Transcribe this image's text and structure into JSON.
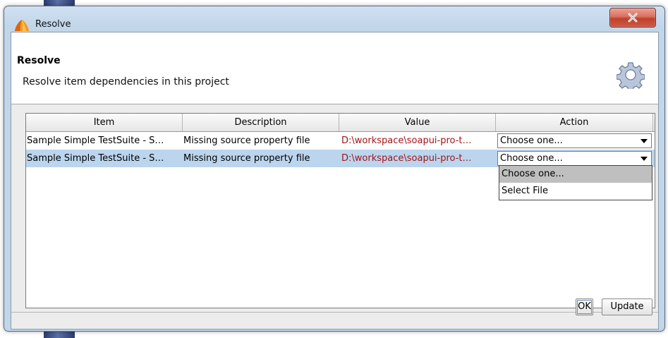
{
  "window": {
    "title": "Resolve",
    "close_label": "x"
  },
  "header": {
    "title": "Resolve",
    "subtitle": "Resolve item dependencies in this project",
    "icon": "gear-icon"
  },
  "table": {
    "columns": [
      "Item",
      "Description",
      "Value",
      "Action"
    ],
    "rows": [
      {
        "item": "Sample Simple TestSuite - S…",
        "description": "Missing source property file",
        "value": "D:\\workspace\\soapui-pro-t…",
        "action": "Choose one...",
        "selected": false
      },
      {
        "item": "Sample Simple TestSuite - S…",
        "description": "Missing source property file",
        "value": "D:\\workspace\\soapui-pro-t…",
        "action": "Choose one...",
        "selected": true
      }
    ],
    "dropdown_options": [
      "Choose one...",
      "Select File"
    ],
    "dropdown_highlighted": "Choose one..."
  },
  "buttons": {
    "ok": "OK",
    "update": "Update"
  },
  "colors": {
    "value_text": "#a11515",
    "selected_row": "#bcd5ee",
    "close_button": "#c1402b"
  }
}
